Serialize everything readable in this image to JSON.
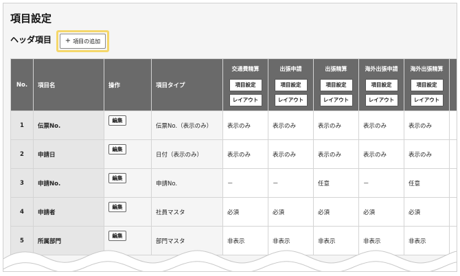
{
  "page_title": "項目設定",
  "section_label": "ヘッダ項目",
  "add_button": {
    "icon": "plus-icon",
    "label": "項目の追加"
  },
  "highlight_color": "#f5d76a",
  "columns": {
    "no": "No.",
    "name": "項目名",
    "op": "操作",
    "type": "項目タイプ"
  },
  "flag_columns": [
    {
      "title": "交通費精算",
      "settings_label": "項目設定",
      "layout_label": "レイアウト"
    },
    {
      "title": "出張申請",
      "settings_label": "項目設定",
      "layout_label": "レイアウト"
    },
    {
      "title": "出張精算",
      "settings_label": "項目設定",
      "layout_label": "レイアウト"
    },
    {
      "title": "海外出張申請",
      "settings_label": "項目設定",
      "layout_label": "レイアウト"
    },
    {
      "title": "海外出張精算",
      "settings_label": "項目設定",
      "layout_label": "レイアウト"
    }
  ],
  "edit_label": "編集",
  "rows": [
    {
      "no": "1",
      "name": "伝票No.",
      "type": "伝票No.（表示のみ）",
      "values": [
        "表示のみ",
        "表示のみ",
        "表示のみ",
        "表示のみ",
        "表示のみ"
      ]
    },
    {
      "no": "2",
      "name": "申請日",
      "type": "日付（表示のみ）",
      "values": [
        "表示のみ",
        "表示のみ",
        "表示のみ",
        "表示のみ",
        "表示のみ"
      ]
    },
    {
      "no": "3",
      "name": "申請No.",
      "type": "申請No.",
      "values": [
        "－",
        "－",
        "任意",
        "－",
        "任意"
      ]
    },
    {
      "no": "4",
      "name": "申請者",
      "type": "社員マスタ",
      "values": [
        "必須",
        "必須",
        "必須",
        "必須",
        "必須"
      ]
    },
    {
      "no": "5",
      "name": "所属部門",
      "type": "部門マスタ",
      "values": [
        "非表示",
        "非表示",
        "非表示",
        "非表示",
        "非表示"
      ]
    }
  ]
}
